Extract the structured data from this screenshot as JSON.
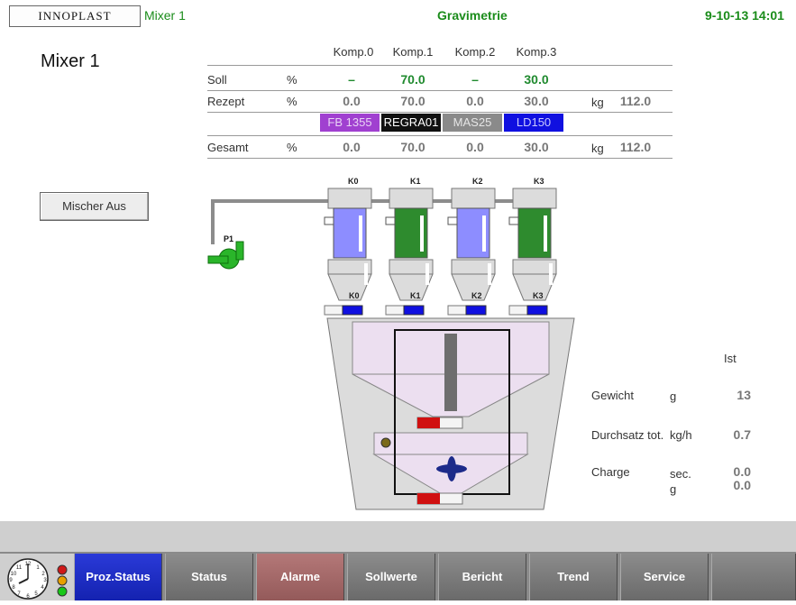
{
  "header": {
    "logo_text": "INNOPLAST",
    "machine": "Mixer 1",
    "title": "Gravimetrie",
    "datetime": "9-10-13 14:01"
  },
  "page_title": "Mixer 1",
  "table": {
    "columns": [
      "Komp.0",
      "Komp.1",
      "Komp.2",
      "Komp.3"
    ],
    "rows": {
      "soll": {
        "label": "Soll",
        "unit": "%",
        "values": [
          "–",
          "70.0",
          "–",
          "30.0"
        ]
      },
      "rezept": {
        "label": "Rezept",
        "unit": "%",
        "values": [
          "0.0",
          "70.0",
          "0.0",
          "30.0"
        ],
        "total_unit": "kg",
        "total": "112.0"
      },
      "gesamt": {
        "label": "Gesamt",
        "unit": "%",
        "values": [
          "0.0",
          "70.0",
          "0.0",
          "30.0"
        ],
        "total_unit": "kg",
        "total": "112.0"
      }
    },
    "materials": [
      {
        "name": "FB 1355",
        "bg": "#a040d0",
        "fg": "#e9d2f5"
      },
      {
        "name": "REGRA01",
        "bg": "#111111",
        "fg": "#ffffff"
      },
      {
        "name": "MAS25",
        "bg": "#8a8a8a",
        "fg": "#e6e6e6"
      },
      {
        "name": "LD150",
        "bg": "#1010e0",
        "fg": "#c9c9ff"
      }
    ]
  },
  "buttons": {
    "mischer": "Mischer Aus"
  },
  "diagram": {
    "pump_label": "P1",
    "hopper_labels": [
      "K0",
      "K1",
      "K2",
      "K3"
    ],
    "valve_labels": [
      "K0",
      "K1",
      "K2",
      "K3"
    ],
    "colors": {
      "blue_material": "#8d8dff",
      "green_material": "#2e8b2e",
      "pump": "#2ab52a",
      "indicator_blue": "#1010e0",
      "indicator_red": "#d01010",
      "mixer_fill": "#ecdff0",
      "funnel_fill": "#dcdcdc"
    }
  },
  "process": {
    "header": "Ist",
    "rows": [
      {
        "label": "Gewicht",
        "unit": "g",
        "value": "13"
      },
      {
        "label": "Durchsatz tot.",
        "unit": "kg/h",
        "value": "0.7"
      },
      {
        "label": "Charge",
        "unit": "sec.",
        "value": "0.0"
      },
      {
        "label": "",
        "unit": "g",
        "value": "0.0"
      }
    ]
  },
  "nav": {
    "items": [
      "Proz.Status",
      "Status",
      "Alarme",
      "Sollwerte",
      "Bericht",
      "Trend",
      "Service",
      ""
    ],
    "active": "Proz.Status"
  },
  "status_lights": {
    "colors": [
      "#d01818",
      "#e8a000",
      "#18c818"
    ]
  }
}
